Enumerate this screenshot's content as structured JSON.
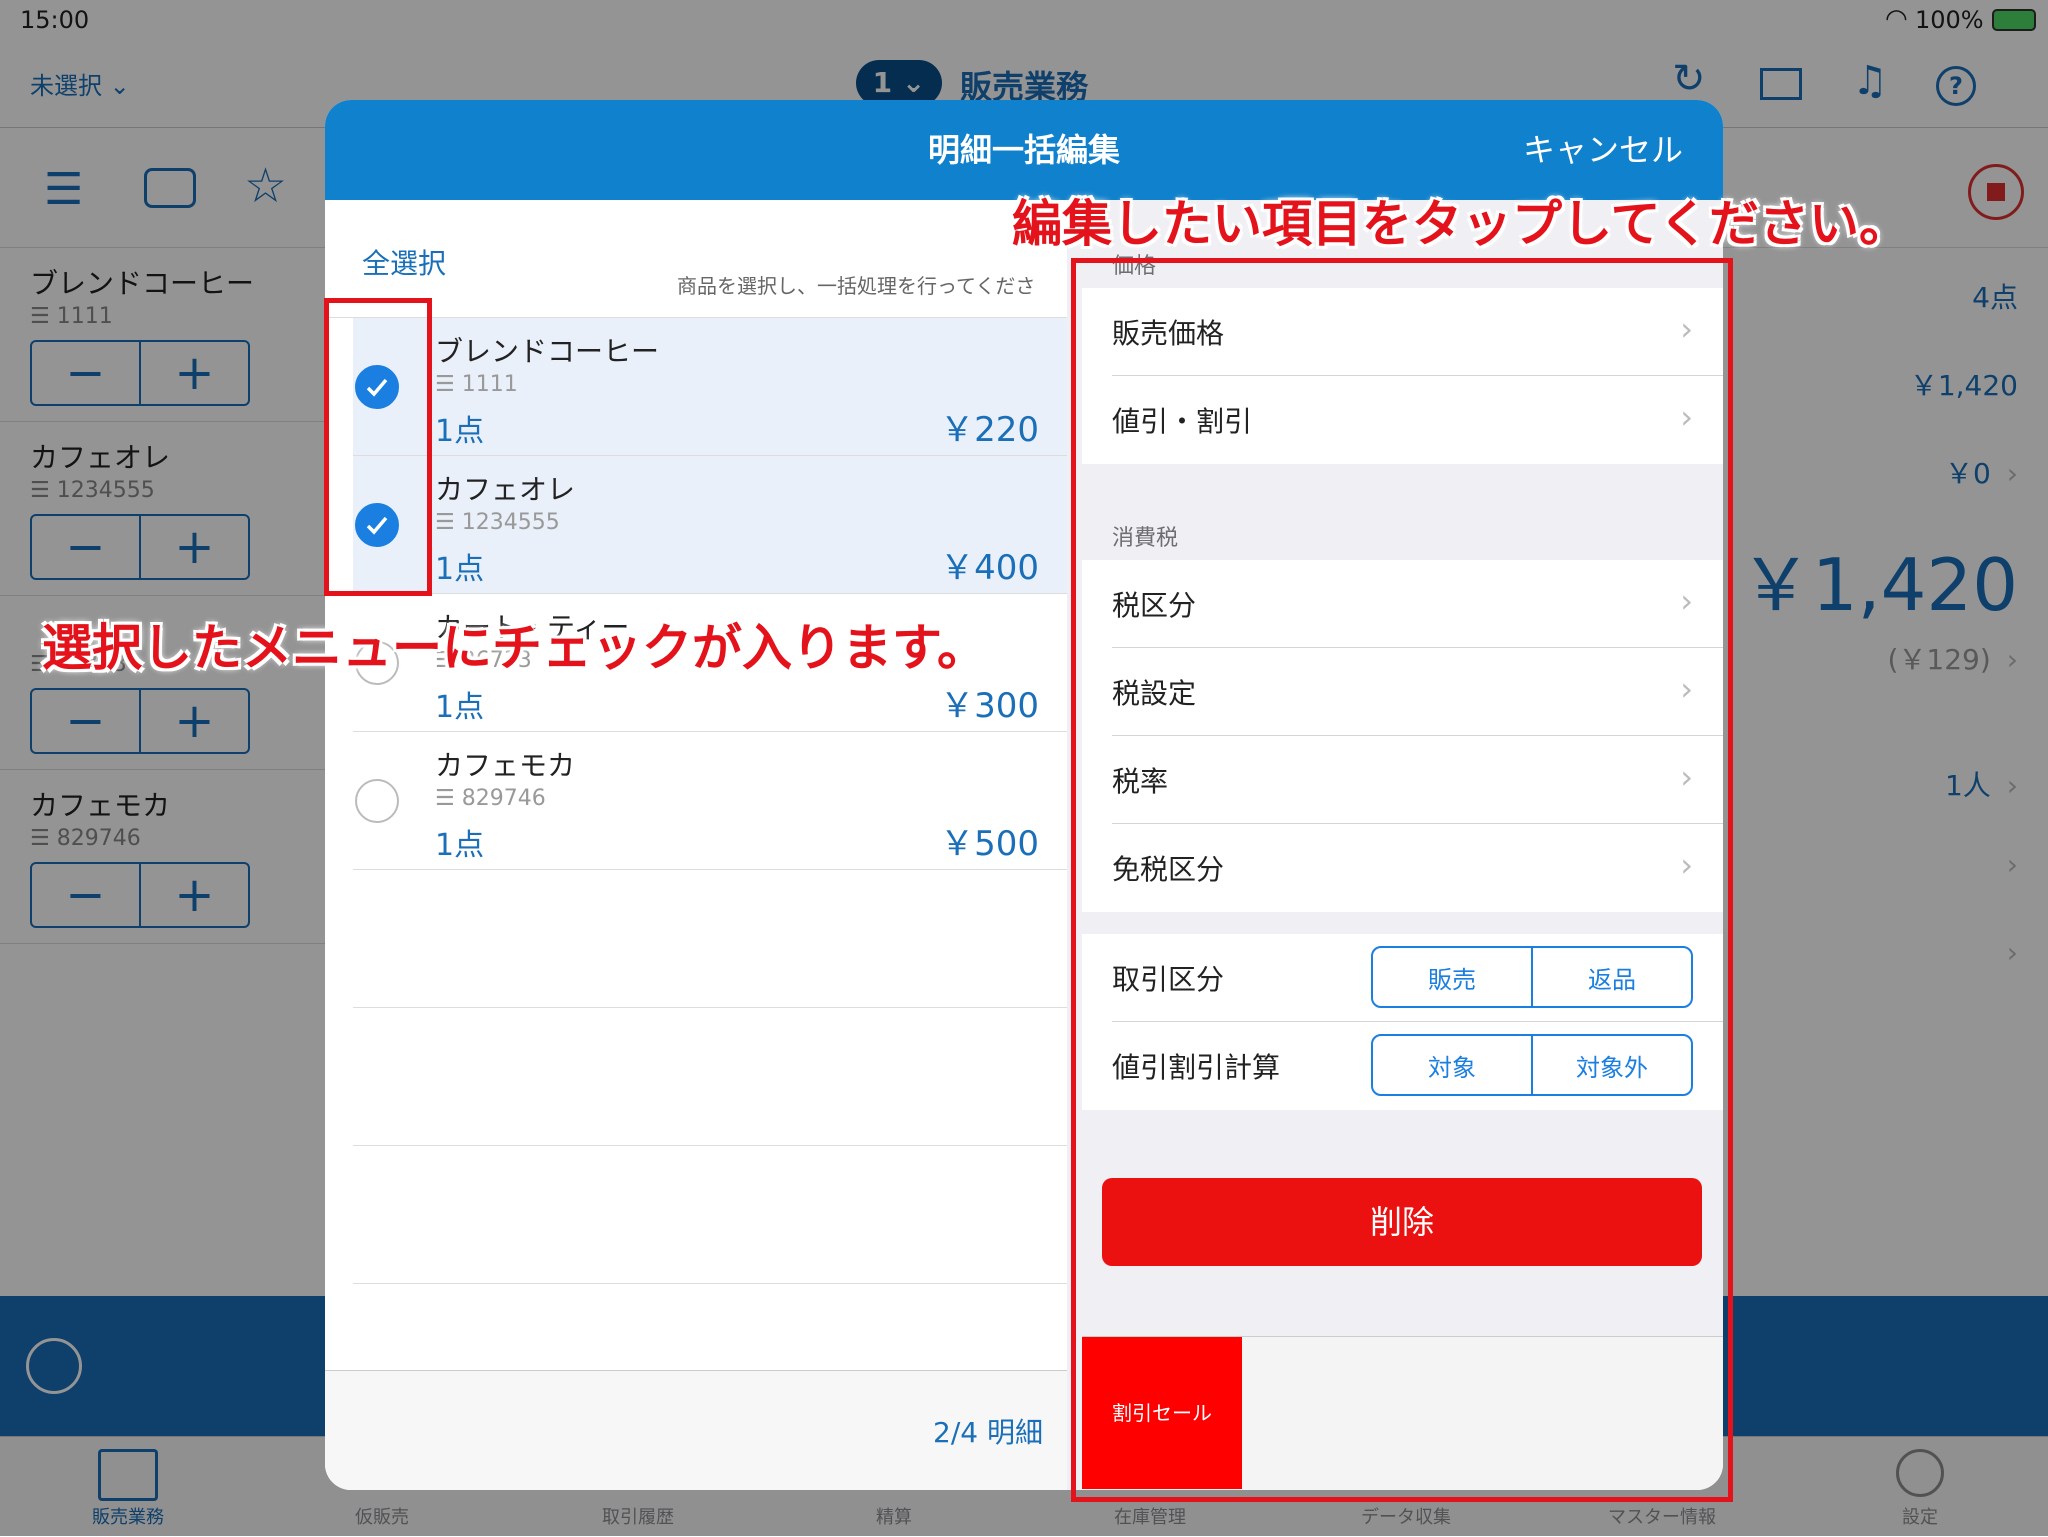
{
  "status": {
    "time": "15:00",
    "battery": "100%"
  },
  "nav": {
    "staff": "未選択",
    "register_badge": "1",
    "title": "販売業務"
  },
  "background": {
    "items": [
      {
        "name": "ブレンドコーヒー",
        "code": "1111"
      },
      {
        "name": "カフェオレ",
        "code": "1234555"
      },
      {
        "name": "カフェモカ",
        "code": "829746"
      }
    ],
    "partial_code": "26733",
    "summary": {
      "count": "4点",
      "subtotal": "￥1,420",
      "discount": "￥0",
      "total": "￥1,420",
      "tax": "(￥129)",
      "guests": "1人"
    }
  },
  "tabbar": [
    "販売業務",
    "仮販売",
    "取引履歴",
    "精算",
    "在庫管理",
    "データ収集",
    "マスター情報",
    "設定"
  ],
  "modal": {
    "title": "明細一括編集",
    "cancel": "キャンセル",
    "select_all": "全選択",
    "hint": "商品を選択し、一括処理を行ってくださ",
    "items": [
      {
        "name": "ブレンドコーヒー",
        "code": "1111",
        "qty": "1点",
        "price": "￥220",
        "selected": true
      },
      {
        "name": "カフェオレ",
        "code": "1234555",
        "qty": "1点",
        "price": "￥400",
        "selected": true
      },
      {
        "name": "カート・ティー",
        "code": "26733",
        "qty": "1点",
        "price": "￥300",
        "selected": false
      },
      {
        "name": "カフェモカ",
        "code": "829746",
        "qty": "1点",
        "price": "￥500",
        "selected": false
      }
    ],
    "footer": "2/4 明細",
    "price_section": "価格",
    "price_rows": [
      "販売価格",
      "値引・割引"
    ],
    "tax_section": "消費税",
    "tax_rows": [
      "税区分",
      "税設定",
      "税率",
      "免税区分"
    ],
    "transaction_type": {
      "label": "取引区分",
      "options": [
        "販売",
        "返品"
      ]
    },
    "discount_calc": {
      "label": "値引割引計算",
      "options": [
        "対象",
        "対象外"
      ]
    },
    "delete": "削除",
    "preset": "割引セール"
  },
  "annotations": {
    "left": "選択したメニューにチェックが入ります。",
    "right": "編集したい項目をタップしてください。"
  },
  "colors": {
    "header_blue": "#1081cc",
    "accent": "#1a6fb8",
    "delete_red": "#ec1111",
    "annotation_red": "#e4121b"
  }
}
